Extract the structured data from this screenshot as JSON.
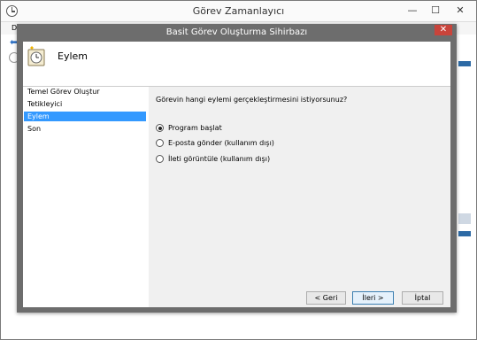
{
  "outer_window": {
    "title": "Görev Zamanlayıcı",
    "minimize": "—",
    "maximize": "☐",
    "close": "✕",
    "menu_label": "Do"
  },
  "wizard": {
    "title": "Basit Görev Oluşturma Sihirbazı",
    "close": "✕",
    "header_title": "Eylem",
    "steps": [
      {
        "label": "Temel Görev Oluştur"
      },
      {
        "label": "Tetikleyici"
      },
      {
        "label": "Eylem"
      },
      {
        "label": "Son"
      }
    ],
    "question": "Görevin hangi eylemi gerçekleştirmesini istiyorsunuz?",
    "options": [
      {
        "label": "Program başlat",
        "checked": true
      },
      {
        "label": "E-posta gönder (kullanım dışı)",
        "checked": false
      },
      {
        "label": "İleti görüntüle (kullanım dışı)",
        "checked": false
      }
    ],
    "buttons": {
      "back": "< Geri",
      "next": "İleri >",
      "cancel": "İptal"
    }
  },
  "icons": {
    "app": "clock-icon",
    "header": "task-wizard-icon"
  },
  "colors": {
    "selection": "#3399ff",
    "close_button": "#c9443b",
    "dialog_frame": "#6d6d6d"
  }
}
